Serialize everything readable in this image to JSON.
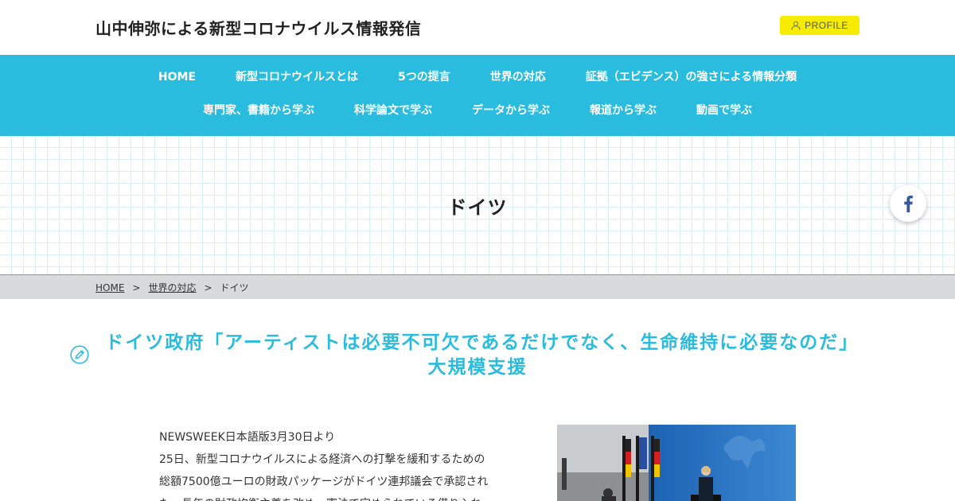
{
  "site": {
    "title": "山中伸弥による新型コロナウイルス情報発信",
    "profile_label": "PROFILE"
  },
  "nav": {
    "row1": [
      "HOME",
      "新型コロナウイルスとは",
      "5つの提言",
      "世界の対応",
      "証拠（エビデンス）の強さによる情報分類"
    ],
    "row2": [
      "専門家、書籍から学ぶ",
      "科学論文で学ぶ",
      "データから学ぶ",
      "報道から学ぶ",
      "動画で学ぶ"
    ]
  },
  "hero": {
    "title": "ドイツ"
  },
  "breadcrumb": {
    "home": "HOME",
    "sep": ">",
    "parent": "世界の対応",
    "current": "ドイツ"
  },
  "article": {
    "title": "ドイツ政府「アーティストは必要不可欠であるだけでなく、生命維持に必要なのだ」大規模支援",
    "lines": [
      "NEWSWEEK日本語版3月30日より",
      "25日、新型コロナウイルスによる経済への打撃を緩和するための",
      "総額7500億ユーロの財政パッケージがドイツ連邦議会で承認され",
      "た。長年の財政均衡主義を改め、憲法で定められている借り入れ"
    ]
  },
  "colors": {
    "accent": "#29bcdf",
    "profile_bg": "#f6ec00",
    "breadcrumb_bg": "#d7dbdc",
    "facebook": "#3b5998"
  },
  "icons": {
    "profile": "user-icon",
    "share": "facebook-icon",
    "heading": "pencil-icon"
  }
}
